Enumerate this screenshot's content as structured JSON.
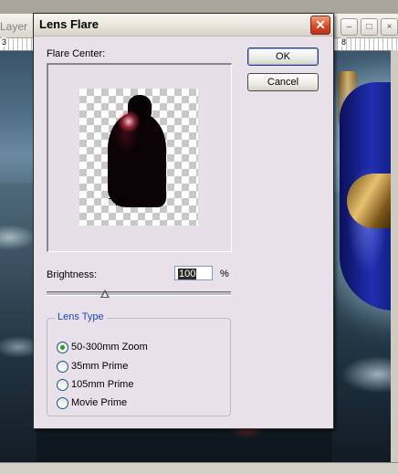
{
  "background": {
    "title_fragment": "Layer",
    "ruler_left": "3",
    "ruler_right": "8",
    "buttons": [
      "–",
      "□",
      "×"
    ]
  },
  "dialog": {
    "title": "Lens Flare",
    "close_glyph": "✕",
    "flare_center_label": "Flare Center:",
    "ok_label": "OK",
    "cancel_label": "Cancel",
    "brightness_label": "Brightness:",
    "brightness_value": "100",
    "brightness_unit": "%",
    "brightness_percent": 100,
    "lens_type": {
      "title": "Lens Type",
      "options": [
        {
          "label": "50-300mm Zoom",
          "checked": true
        },
        {
          "label": "35mm Prime",
          "checked": false
        },
        {
          "label": "105mm Prime",
          "checked": false
        },
        {
          "label": "Movie Prime",
          "checked": false
        }
      ]
    }
  }
}
